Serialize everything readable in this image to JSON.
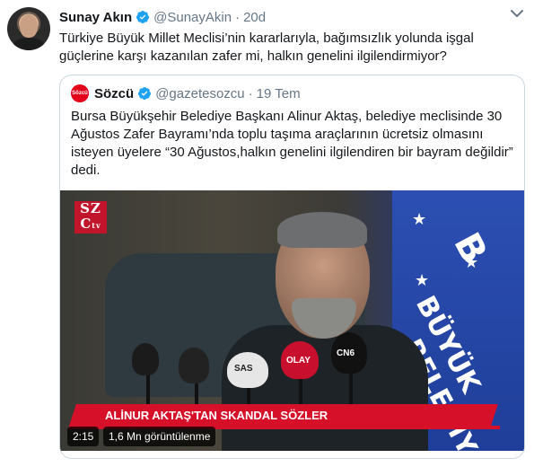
{
  "author": {
    "name": "Sunay Akın",
    "handle": "@SunayAkin",
    "separator": "·",
    "time": "20d",
    "verified": true
  },
  "tweet": {
    "text": "Türkiye Büyük Millet Meclisi’nin kararlarıyla, bağımsızlık yolunda işgal güçlerine karşı kazanılan zafer mi, halkın genelini ilgilendirmiyor?"
  },
  "quoted": {
    "avatar_text": "Sözcü",
    "name": "Sözcü",
    "handle": "@gazetesozcu",
    "separator": "·",
    "time": "19 Tem",
    "verified": true,
    "text": "Bursa Büyükşehir Belediye Başkanı Alinur Aktaş, belediye meclisinde 30 Ağustos Zafer Bayramı’nda toplu taşıma araçlarının ücretsiz olmasını isteyen üyelere “30 Ağustos,halkın genelini ilgilendiren bir bayram değildir” dedi.",
    "video": {
      "logo_text_top": "SZ",
      "logo_text_bottom": "C",
      "logo_tv": "tv",
      "ticker": "ALİNUR AKTAŞ'TAN SKANDAL SÖZLER",
      "flag_words": [
        "B",
        "BÜYÜK",
        "BELEDİY"
      ],
      "mic_labels": [
        "SAS",
        "OLAY",
        "CN6"
      ],
      "duration": "2:15",
      "views": "1,6 Mn görüntülenme"
    }
  },
  "colors": {
    "verified": "#1da1f2",
    "secondary_text": "#657786",
    "ticker": "#d7102a",
    "border": "#ccd6dd"
  },
  "icons": [
    "verified-badge-icon",
    "chevron-down-icon"
  ]
}
